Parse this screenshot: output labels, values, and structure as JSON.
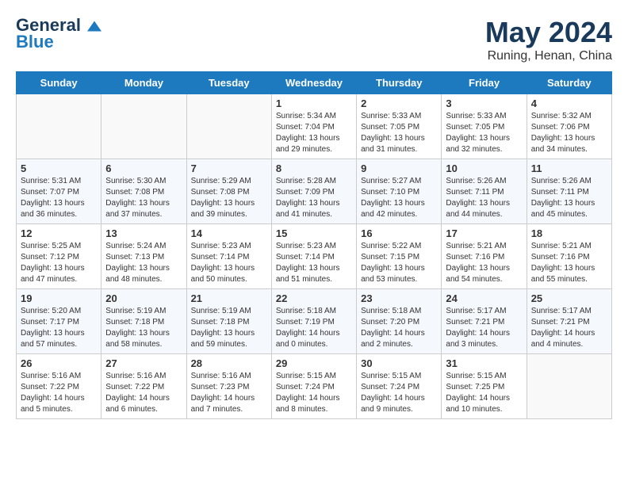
{
  "logo": {
    "line1": "General",
    "line2": "Blue"
  },
  "title": "May 2024",
  "location": "Runing, Henan, China",
  "weekdays": [
    "Sunday",
    "Monday",
    "Tuesday",
    "Wednesday",
    "Thursday",
    "Friday",
    "Saturday"
  ],
  "weeks": [
    [
      {
        "day": "",
        "detail": ""
      },
      {
        "day": "",
        "detail": ""
      },
      {
        "day": "",
        "detail": ""
      },
      {
        "day": "1",
        "detail": "Sunrise: 5:34 AM\nSunset: 7:04 PM\nDaylight: 13 hours\nand 29 minutes."
      },
      {
        "day": "2",
        "detail": "Sunrise: 5:33 AM\nSunset: 7:05 PM\nDaylight: 13 hours\nand 31 minutes."
      },
      {
        "day": "3",
        "detail": "Sunrise: 5:33 AM\nSunset: 7:05 PM\nDaylight: 13 hours\nand 32 minutes."
      },
      {
        "day": "4",
        "detail": "Sunrise: 5:32 AM\nSunset: 7:06 PM\nDaylight: 13 hours\nand 34 minutes."
      }
    ],
    [
      {
        "day": "5",
        "detail": "Sunrise: 5:31 AM\nSunset: 7:07 PM\nDaylight: 13 hours\nand 36 minutes."
      },
      {
        "day": "6",
        "detail": "Sunrise: 5:30 AM\nSunset: 7:08 PM\nDaylight: 13 hours\nand 37 minutes."
      },
      {
        "day": "7",
        "detail": "Sunrise: 5:29 AM\nSunset: 7:08 PM\nDaylight: 13 hours\nand 39 minutes."
      },
      {
        "day": "8",
        "detail": "Sunrise: 5:28 AM\nSunset: 7:09 PM\nDaylight: 13 hours\nand 41 minutes."
      },
      {
        "day": "9",
        "detail": "Sunrise: 5:27 AM\nSunset: 7:10 PM\nDaylight: 13 hours\nand 42 minutes."
      },
      {
        "day": "10",
        "detail": "Sunrise: 5:26 AM\nSunset: 7:11 PM\nDaylight: 13 hours\nand 44 minutes."
      },
      {
        "day": "11",
        "detail": "Sunrise: 5:26 AM\nSunset: 7:11 PM\nDaylight: 13 hours\nand 45 minutes."
      }
    ],
    [
      {
        "day": "12",
        "detail": "Sunrise: 5:25 AM\nSunset: 7:12 PM\nDaylight: 13 hours\nand 47 minutes."
      },
      {
        "day": "13",
        "detail": "Sunrise: 5:24 AM\nSunset: 7:13 PM\nDaylight: 13 hours\nand 48 minutes."
      },
      {
        "day": "14",
        "detail": "Sunrise: 5:23 AM\nSunset: 7:14 PM\nDaylight: 13 hours\nand 50 minutes."
      },
      {
        "day": "15",
        "detail": "Sunrise: 5:23 AM\nSunset: 7:14 PM\nDaylight: 13 hours\nand 51 minutes."
      },
      {
        "day": "16",
        "detail": "Sunrise: 5:22 AM\nSunset: 7:15 PM\nDaylight: 13 hours\nand 53 minutes."
      },
      {
        "day": "17",
        "detail": "Sunrise: 5:21 AM\nSunset: 7:16 PM\nDaylight: 13 hours\nand 54 minutes."
      },
      {
        "day": "18",
        "detail": "Sunrise: 5:21 AM\nSunset: 7:16 PM\nDaylight: 13 hours\nand 55 minutes."
      }
    ],
    [
      {
        "day": "19",
        "detail": "Sunrise: 5:20 AM\nSunset: 7:17 PM\nDaylight: 13 hours\nand 57 minutes."
      },
      {
        "day": "20",
        "detail": "Sunrise: 5:19 AM\nSunset: 7:18 PM\nDaylight: 13 hours\nand 58 minutes."
      },
      {
        "day": "21",
        "detail": "Sunrise: 5:19 AM\nSunset: 7:18 PM\nDaylight: 13 hours\nand 59 minutes."
      },
      {
        "day": "22",
        "detail": "Sunrise: 5:18 AM\nSunset: 7:19 PM\nDaylight: 14 hours\nand 0 minutes."
      },
      {
        "day": "23",
        "detail": "Sunrise: 5:18 AM\nSunset: 7:20 PM\nDaylight: 14 hours\nand 2 minutes."
      },
      {
        "day": "24",
        "detail": "Sunrise: 5:17 AM\nSunset: 7:21 PM\nDaylight: 14 hours\nand 3 minutes."
      },
      {
        "day": "25",
        "detail": "Sunrise: 5:17 AM\nSunset: 7:21 PM\nDaylight: 14 hours\nand 4 minutes."
      }
    ],
    [
      {
        "day": "26",
        "detail": "Sunrise: 5:16 AM\nSunset: 7:22 PM\nDaylight: 14 hours\nand 5 minutes."
      },
      {
        "day": "27",
        "detail": "Sunrise: 5:16 AM\nSunset: 7:22 PM\nDaylight: 14 hours\nand 6 minutes."
      },
      {
        "day": "28",
        "detail": "Sunrise: 5:16 AM\nSunset: 7:23 PM\nDaylight: 14 hours\nand 7 minutes."
      },
      {
        "day": "29",
        "detail": "Sunrise: 5:15 AM\nSunset: 7:24 PM\nDaylight: 14 hours\nand 8 minutes."
      },
      {
        "day": "30",
        "detail": "Sunrise: 5:15 AM\nSunset: 7:24 PM\nDaylight: 14 hours\nand 9 minutes."
      },
      {
        "day": "31",
        "detail": "Sunrise: 5:15 AM\nSunset: 7:25 PM\nDaylight: 14 hours\nand 10 minutes."
      },
      {
        "day": "",
        "detail": ""
      }
    ]
  ]
}
